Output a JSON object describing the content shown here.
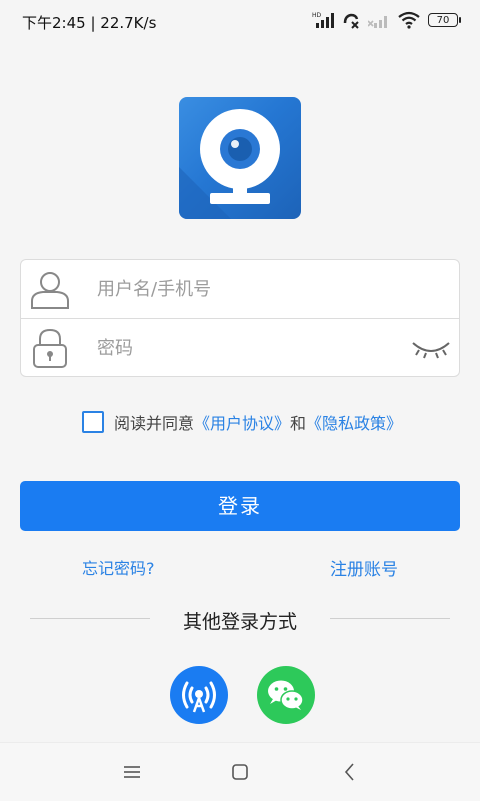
{
  "status_bar": {
    "time_speed": "下午2:45 | 22.7K/s",
    "battery": "70",
    "icons": [
      "hd-signal-icon",
      "call-off-icon",
      "no-signal-icon",
      "wifi-icon",
      "battery-icon"
    ]
  },
  "app": {
    "logo_icon": "webcam-icon",
    "brand_color": "#2577d3"
  },
  "form": {
    "username_placeholder": "用户名/手机号",
    "username_value": "",
    "password_placeholder": "密码",
    "password_value": ""
  },
  "agreement": {
    "checked": false,
    "prefix": "阅读并同意",
    "user_agreement": "《用户协议》",
    "conjunction": "和",
    "privacy_policy": "《隐私政策》"
  },
  "login_label": "登录",
  "forgot_password_label": "忘记密码?",
  "register_label": "注册账号",
  "other_login": {
    "title": "其他登录方式",
    "methods": [
      {
        "icon": "signal-tower-icon",
        "color": "#1a7cf2"
      },
      {
        "icon": "wechat-icon",
        "color": "#2dc95a"
      }
    ]
  },
  "nav_bar": {
    "icons": [
      "menu-icon",
      "home-icon",
      "back-icon"
    ]
  }
}
